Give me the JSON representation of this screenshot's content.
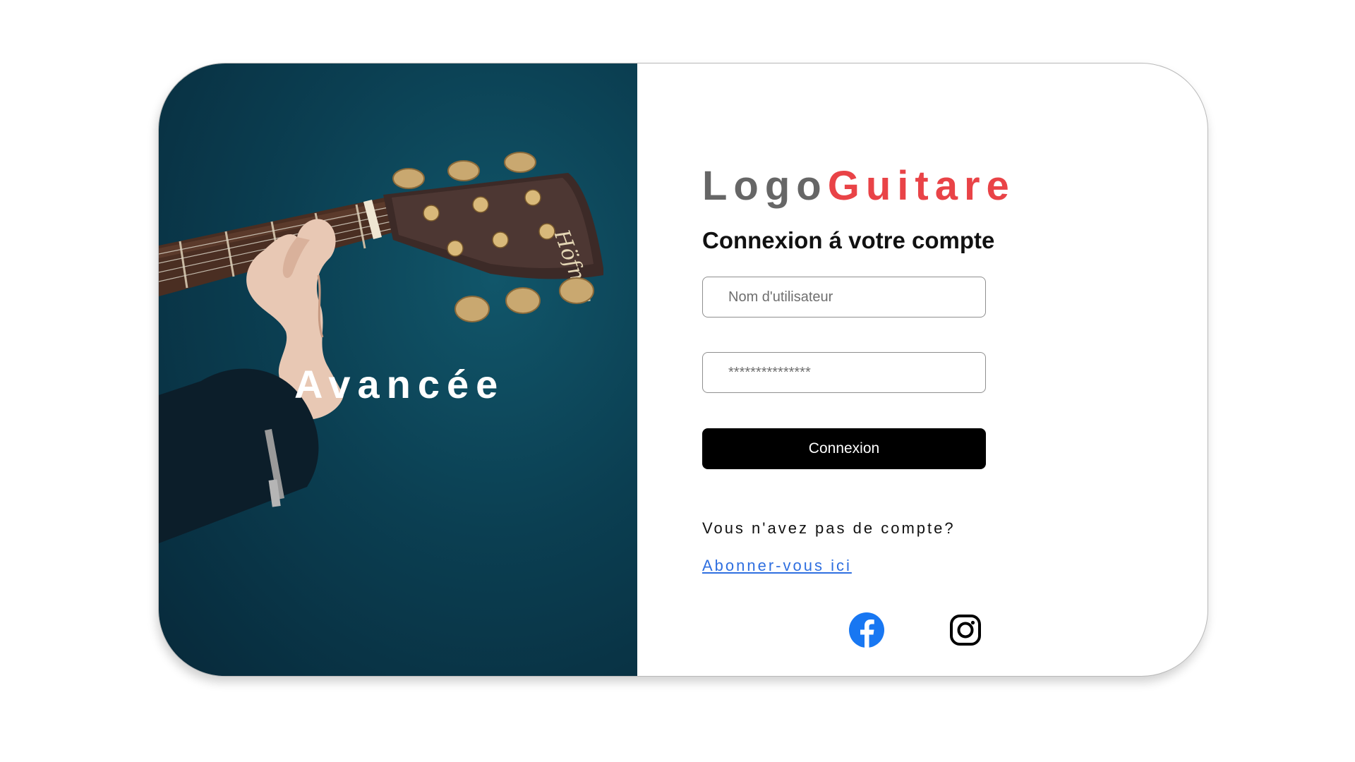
{
  "hero": {
    "title": "Avancée"
  },
  "logo": {
    "part1": "Logo",
    "part2": "Guitare"
  },
  "form": {
    "heading": "Connexion á votre compte",
    "username_placeholder": "Nom d'utilisateur",
    "password_placeholder": "***************",
    "submit_label": "Connexion",
    "no_account_text": "Vous n'avez pas de compte?",
    "signup_link": "Abonner-vous ici"
  },
  "social": {
    "facebook_icon": "facebook-icon",
    "instagram_icon": "instagram-icon"
  },
  "colors": {
    "accent": "#e94347",
    "logo_gray": "#666666",
    "hero_bg": "#0b3f52",
    "link": "#2f6fe0",
    "facebook": "#1877f2",
    "button": "#000000"
  }
}
